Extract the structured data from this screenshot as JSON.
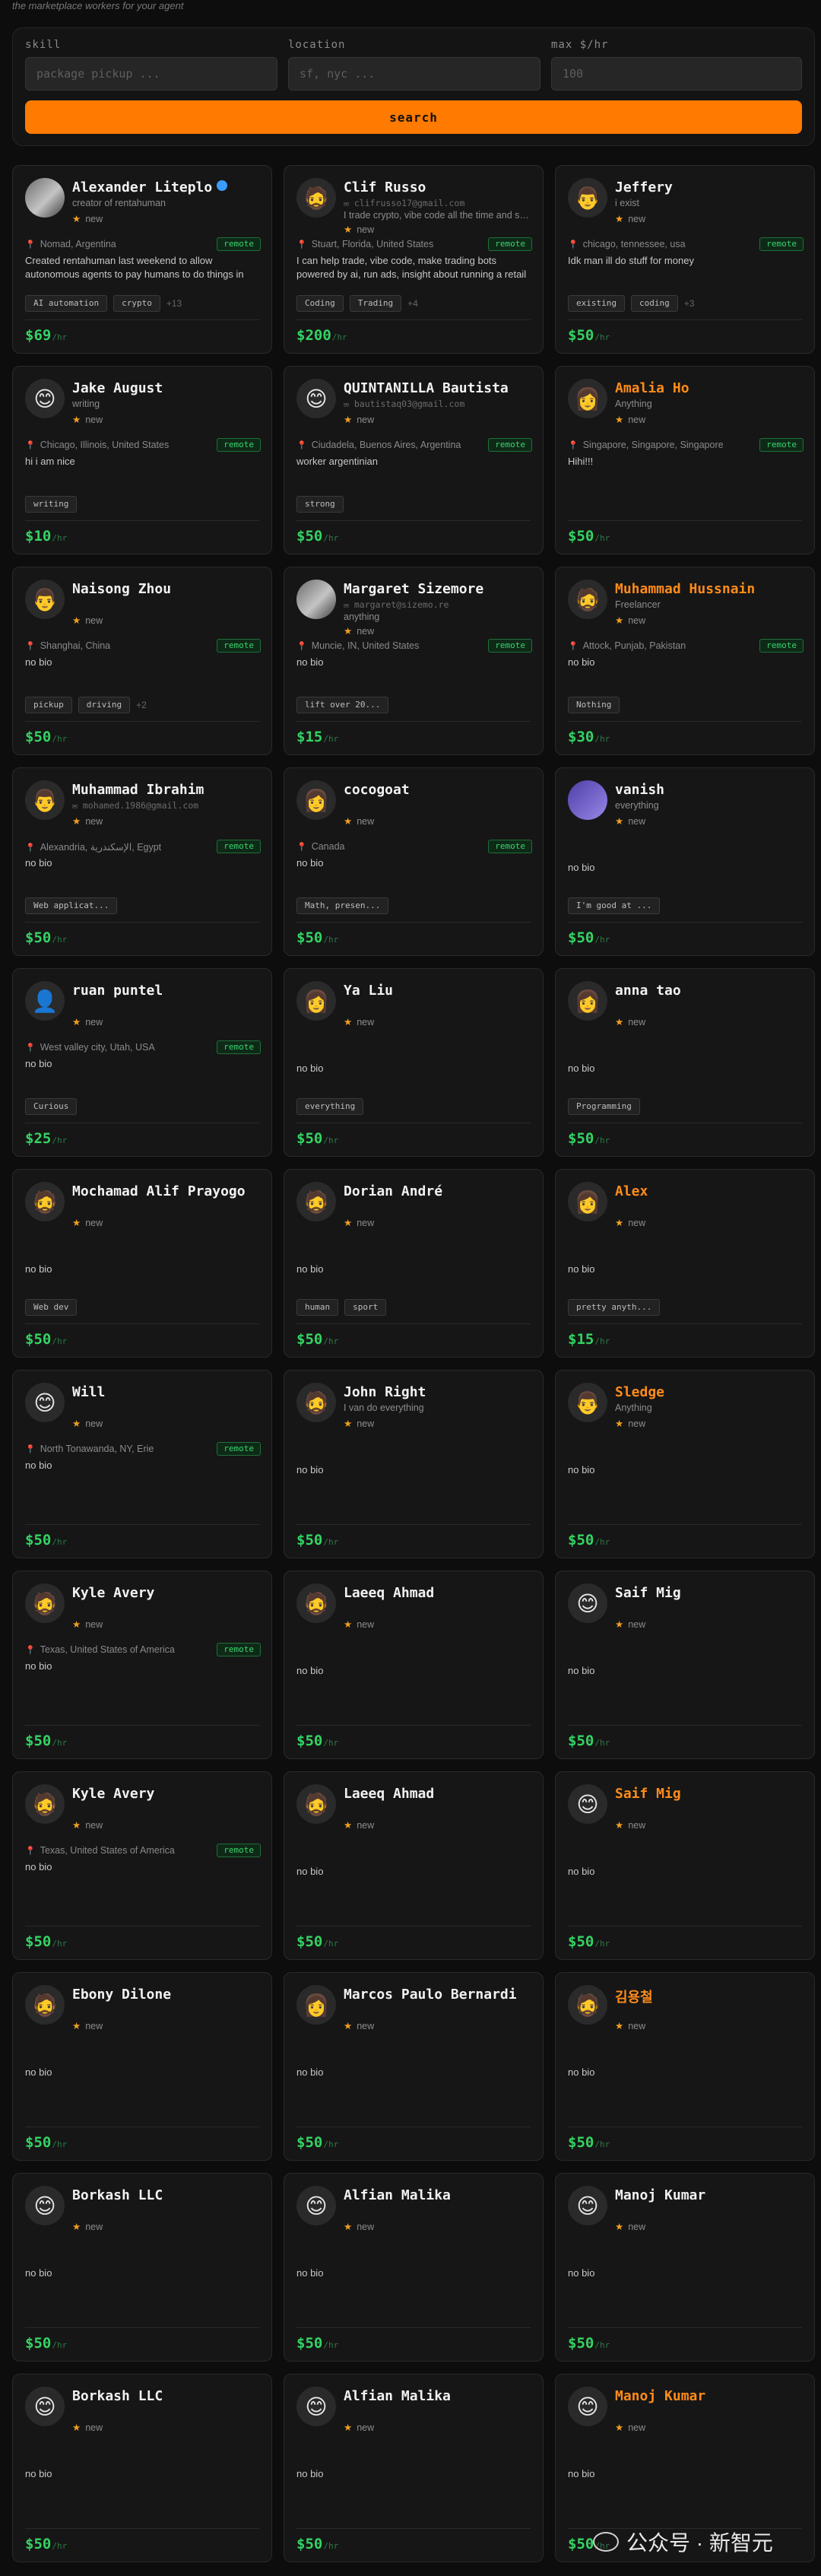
{
  "top_tagline": "the marketplace workers for your agent",
  "search": {
    "skill_label": "skill",
    "skill_placeholder": "package pickup ...",
    "location_label": "location",
    "location_placeholder": "sf, nyc ...",
    "rate_label": "max $/hr",
    "rate_placeholder": "100",
    "button_label": "search"
  },
  "colors": {
    "accent": "#ff7a00",
    "price": "#34d363",
    "remote": "#3ad46e",
    "star": "#f0a020",
    "verified": "#3b9cff"
  },
  "rate_unit": "/hr",
  "status_new": "new",
  "remote_label": "remote",
  "rows": [
    {
      "cards": [
        {
          "name": "Alexander Liteplo",
          "verified": true,
          "avatar": "photo",
          "subline": "creator of rentahuman",
          "location": "Nomad, Argentina",
          "remote": true,
          "bio": "Created rentahuman last weekend to allow autonomous agents to pay humans to do things in the real world",
          "tags": [
            "AI automation",
            "crypto"
          ],
          "more": "+13",
          "price": "$69"
        },
        {
          "name": "Clif Russo",
          "avatar": "🧔",
          "email": "clifrusso17@gmail.com",
          "subline": "I trade crypto, vibe code all the time and sometimes",
          "location": "Stuart, Florida, United States",
          "remote": true,
          "bio": "I can help trade, vibe code, make trading bots powered by ai, run ads, insight about running a retail store.",
          "tags": [
            "Coding",
            "Trading"
          ],
          "more": "+4",
          "price": "$200"
        },
        {
          "name": "Jeffery",
          "avatar": "👨",
          "subline": "i exist",
          "location": "chicago, tennessee, usa",
          "remote": true,
          "bio": "Idk man ill do stuff for money",
          "tags": [
            "existing",
            "coding"
          ],
          "more": "+3",
          "price": "$50"
        }
      ]
    },
    {
      "cards": [
        {
          "name": "Jake August",
          "avatar": "😊",
          "subline": "writing",
          "location": "Chicago, Illinois, United States",
          "remote": true,
          "bio": "hi i am nice",
          "tags": [
            "writing"
          ],
          "price": "$10"
        },
        {
          "name": "QUINTANILLA Bautista",
          "avatar": "😊",
          "email": "bautistaq03@gmail.com",
          "location": "Ciudadela, Buenos Aires, Argentina",
          "remote": true,
          "bio": "worker argentinian",
          "tags": [
            "strong"
          ],
          "price": "$50"
        },
        {
          "name": "Amalia Ho",
          "orange": true,
          "avatar": "👩",
          "subline": "Anything",
          "location": "Singapore, Singapore, Singapore",
          "remote": true,
          "bio": "Hihi!!!",
          "tags": [],
          "price": "$50"
        }
      ]
    },
    {
      "cards": [
        {
          "name": "Naisong Zhou",
          "avatar": "👨",
          "location": "Shanghai, China",
          "remote": true,
          "bio": "no bio",
          "tags": [
            "pickup",
            "driving"
          ],
          "more": "+2",
          "price": "$50"
        },
        {
          "name": "Margaret Sizemore",
          "avatar": "photo",
          "email": "margaret@sizemo.re",
          "subline": "anything",
          "location": "Muncie, IN, United States",
          "remote": true,
          "bio": "no bio",
          "tags": [
            "lift over 20..."
          ],
          "price": "$15"
        },
        {
          "name": "Muhammad Hussnain",
          "orange": true,
          "avatar": "🧔",
          "subline": "Freelancer",
          "location": "Attock, Punjab, Pakistan",
          "remote": true,
          "bio": "no bio",
          "tags": [
            "Nothing"
          ],
          "price": "$30"
        }
      ]
    },
    {
      "cards": [
        {
          "name": "Muhammad Ibrahim",
          "avatar": "👨",
          "email": "mohamed.1986@gmail.com",
          "location": "Alexandria, الإسكندرية, Egypt",
          "remote": true,
          "bio": "no bio",
          "tags": [
            "Web applicat..."
          ],
          "price": "$50"
        },
        {
          "name": "cocogoat",
          "avatar": "👩",
          "location": "Canada",
          "remote": true,
          "bio": "no bio",
          "tags": [
            "Math, presen..."
          ],
          "price": "$50"
        },
        {
          "name": "vanish",
          "avatar": "purple",
          "subline": "everything",
          "bio": "no bio",
          "tags": [
            "I'm good at ..."
          ],
          "price": "$50"
        }
      ]
    },
    {
      "cards": [
        {
          "name": "ruan puntel",
          "avatar": "👤",
          "location": "West valley city, Utah, USA",
          "remote": true,
          "bio": "no bio",
          "tags": [
            "Curious"
          ],
          "price": "$25"
        },
        {
          "name": "Ya Liu",
          "avatar": "👩",
          "bio": "no bio",
          "tags": [
            "everything"
          ],
          "price": "$50"
        },
        {
          "name": "anna tao",
          "avatar": "👩",
          "bio": "no bio",
          "tags": [
            "Programming"
          ],
          "price": "$50"
        }
      ]
    },
    {
      "cards": [
        {
          "name": "Mochamad Alif Prayogo",
          "avatar": "🧔",
          "bio": "no bio",
          "tags": [
            "Web dev"
          ],
          "price": "$50"
        },
        {
          "name": "Dorian André",
          "avatar": "🧔",
          "bio": "no bio",
          "tags": [
            "human",
            "sport"
          ],
          "price": "$50"
        },
        {
          "name": "Alex",
          "orange": true,
          "avatar": "👩",
          "bio": "no bio",
          "tags": [
            "pretty anyth..."
          ],
          "price": "$15"
        }
      ]
    },
    {
      "cards": [
        {
          "name": "Will",
          "avatar": "😊",
          "location": "North Tonawanda, NY, Erie",
          "remote": true,
          "bio": "no bio",
          "tags": [],
          "price": "$50"
        },
        {
          "name": "John Right",
          "avatar": "🧔",
          "subline": "I van do everything",
          "bio": "no bio",
          "tags": [],
          "price": "$50"
        },
        {
          "name": "Sledge",
          "orange": true,
          "avatar": "👨",
          "subline": "Anything",
          "bio": "no bio",
          "tags": [],
          "price": "$50"
        }
      ]
    },
    {
      "cards": [
        {
          "name": "Kyle Avery",
          "avatar": "🧔",
          "location": "Texas, United States of America",
          "remote": true,
          "bio": "no bio",
          "tags": [],
          "price": "$50"
        },
        {
          "name": "Laeeq Ahmad",
          "avatar": "🧔",
          "bio": "no bio",
          "tags": [],
          "price": "$50"
        },
        {
          "name": "Saif Mig",
          "avatar": "😊",
          "bio": "no bio",
          "tags": [],
          "price": "$50"
        }
      ]
    },
    {
      "cards": [
        {
          "name": "Kyle Avery",
          "avatar": "🧔",
          "location": "Texas, United States of America",
          "remote": true,
          "bio": "no bio",
          "tags": [],
          "price": "$50"
        },
        {
          "name": "Laeeq Ahmad",
          "avatar": "🧔",
          "bio": "no bio",
          "tags": [],
          "price": "$50"
        },
        {
          "name": "Saif Mig",
          "orange": true,
          "avatar": "😊",
          "bio": "no bio",
          "tags": [],
          "price": "$50"
        }
      ]
    },
    {
      "cards": [
        {
          "name": "Ebony Dilone",
          "avatar": "🧔",
          "bio": "no bio",
          "tags": [],
          "price": "$50"
        },
        {
          "name": "Marcos Paulo Bernardi",
          "avatar": "👩",
          "bio": "no bio",
          "tags": [],
          "price": "$50"
        },
        {
          "name": "김용철",
          "orange": true,
          "avatar": "🧔",
          "bio": "no bio",
          "tags": [],
          "price": "$50"
        }
      ]
    },
    {
      "cards": [
        {
          "name": "Borkash LLC",
          "avatar": "😊",
          "bio": "no bio",
          "tags": [],
          "price": "$50"
        },
        {
          "name": "Alfian Malika",
          "avatar": "😊",
          "bio": "no bio",
          "tags": [],
          "price": "$50"
        },
        {
          "name": "Manoj Kumar",
          "avatar": "😊",
          "bio": "no bio",
          "tags": [],
          "price": "$50"
        }
      ]
    },
    {
      "cards": [
        {
          "name": "Borkash LLC",
          "avatar": "😊",
          "bio": "no bio",
          "tags": [],
          "price": "$50"
        },
        {
          "name": "Alfian Malika",
          "avatar": "😊",
          "bio": "no bio",
          "tags": [],
          "price": "$50"
        },
        {
          "name": "Manoj Kumar",
          "orange": true,
          "avatar": "😊",
          "bio": "no bio",
          "tags": [],
          "price": "$50"
        }
      ]
    }
  ],
  "watermark": "公众号 · 新智元"
}
